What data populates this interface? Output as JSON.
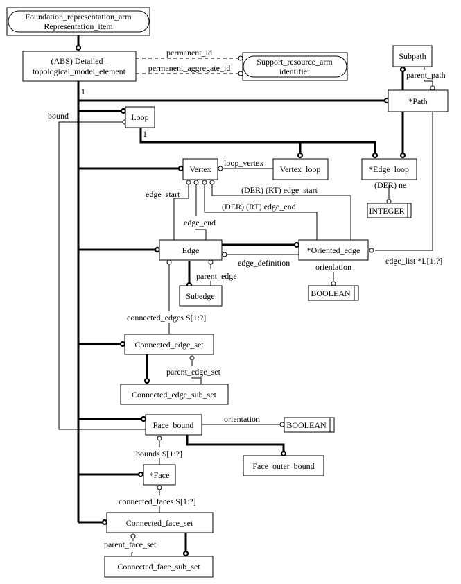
{
  "diagram": {
    "type": "EXPRESS-G schema diagram",
    "entities": {
      "foundation": {
        "line1": "Foundation_representation_arm",
        "line2": "Representation_item"
      },
      "detailed": {
        "line1": "(ABS) Detailed_",
        "line2": "topological_model_element"
      },
      "support": {
        "line1": "Support_resource_arm",
        "line2": "identifier"
      },
      "subpath": "Subpath",
      "path": "*Path",
      "loop": "Loop",
      "vertex": "Vertex",
      "vertex_loop": "Vertex_loop",
      "edge_loop": "*Edge_loop",
      "integer": "INTEGER",
      "edge": "Edge",
      "oriented_edge": "*Oriented_edge",
      "boolean1": "BOOLEAN",
      "subedge": "Subedge",
      "connected_edge_set": "Connected_edge_set",
      "connected_edge_sub_set": "Connected_edge_sub_set",
      "face_bound": "Face_bound",
      "boolean2": "BOOLEAN",
      "face_outer_bound": "Face_outer_bound",
      "face": "*Face",
      "connected_face_set": "Connected_face_set",
      "connected_face_sub_set": "Connected_face_sub_set"
    },
    "labels": {
      "permanent_id": "permanent_id",
      "permanent_aggregate_id": "permanent_aggregate_id",
      "one_a": "1",
      "one_b": "1",
      "bound": "bound",
      "parent_path": "parent_path",
      "loop_vertex": "loop_vertex",
      "edge_start": "edge_start",
      "der_edge_start": "(DER) (RT) edge_start",
      "der_edge_end": "(DER) (RT) edge_end",
      "edge_end": "edge_end",
      "der_ne": "(DER) ne",
      "edge_definition": "edge_definition",
      "orientation1": "orientation",
      "edge_list": "edge_list *L[1:?]",
      "parent_edge": "parent_edge",
      "connected_edges": "connected_edges S[1:?]",
      "parent_edge_set": "parent_edge_set",
      "orientation2": "orientation",
      "bounds": "bounds S[1:?]",
      "connected_faces": "connected_faces S[1:?]",
      "parent_face_set": "parent_face_set"
    }
  }
}
